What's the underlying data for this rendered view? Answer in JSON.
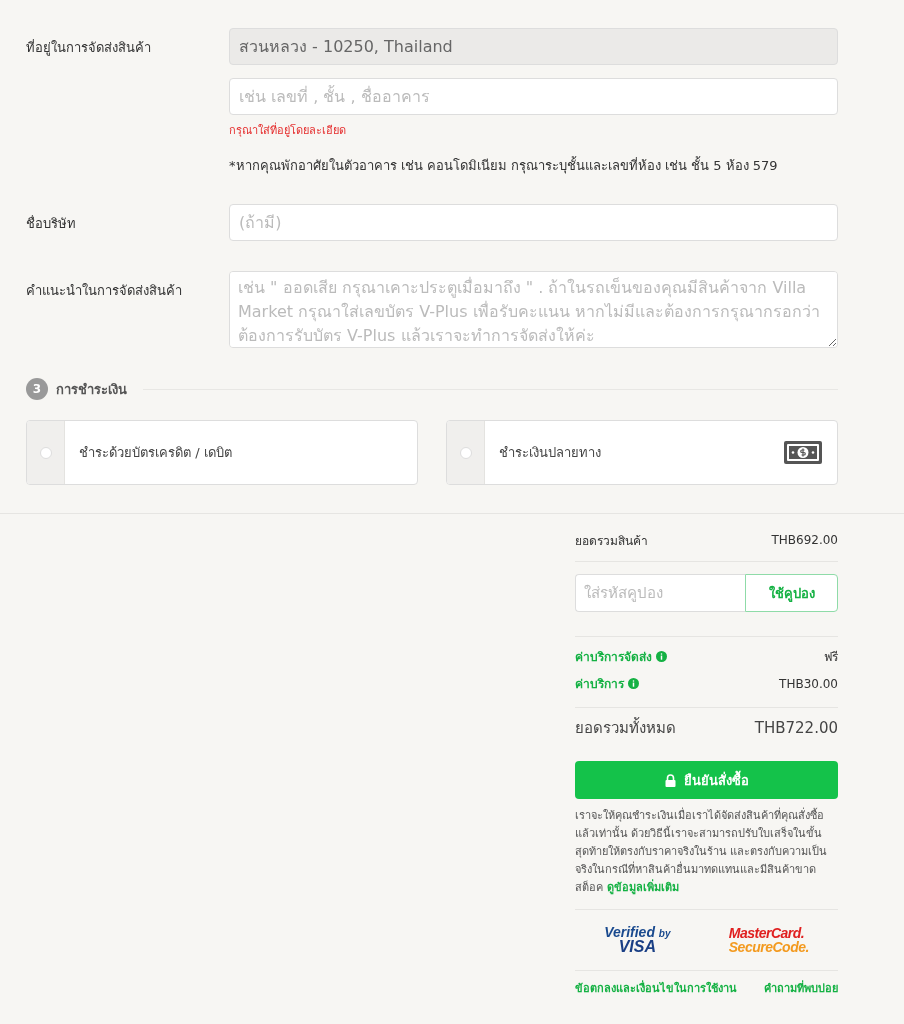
{
  "address": {
    "label": "ที่อยู่ในการจัดส่งสินค้า",
    "area_value": "สวนหลวง - 10250, Thailand",
    "detail_placeholder": "เช่น เลขที่ , ชั้น , ชื่ออาคาร",
    "error": "กรุณาใส่ที่อยู่โดยละเอียด",
    "note": "*หากคุณพักอาศัยในตัวอาคาร เช่น คอนโดมิเนียม กรุณาระบุชั้นและเลขที่ห้อง เช่น ชั้น 5 ห้อง 579"
  },
  "company": {
    "label": "ชื่อบริษัท",
    "placeholder": "(ถ้ามี)"
  },
  "instructions": {
    "label": "คำแนะนำในการจัดส่งสินค้า",
    "placeholder": "เช่น \" ออดเสีย กรุณาเคาะประตูเมื่อมาถึง \" . ถ้าในรถเข็นของคุณมีสินค้าจาก Villa Market กรุณาใส่เลขบัตร V-Plus เพื่อรับคะแนน หากไม่มีและต้องการกรุณากรอกว่าต้องการรับบัตร V-Plus แล้วเราจะทำการจัดส่งให้ค่ะ"
  },
  "payment": {
    "step": "3",
    "title": "การชำระเงิน",
    "options": [
      {
        "label": "ชำระด้วยบัตรเครดิต / เดบิต",
        "selected": false,
        "kind": "card"
      },
      {
        "label": "ชำระเงินปลายทาง",
        "selected": false,
        "kind": "cash"
      }
    ]
  },
  "summary": {
    "subtotal_label": "ยอดรวมสินค้า",
    "subtotal": "THB692.00",
    "coupon_placeholder": "ใส่รหัสคูปอง",
    "coupon_button": "ใช้คูปอง",
    "fees": [
      {
        "label": "ค่าบริการจัดส่ง",
        "value": "ฟรี"
      },
      {
        "label": "ค่าบริการ",
        "value": "THB30.00"
      }
    ],
    "total_label": "ยอดรวมทั้งหมด",
    "total": "THB722.00",
    "confirm_button": "ยืนยันสั่งซื้อ",
    "disclaimer": "เราจะให้คุณชำระเงินเมื่อเราได้จัดส่งสินค้าที่คุณสั่งซื้อแล้วเท่านั้น ด้วยวิธีนี้เราจะสามารถปรับใบเสร็จในขั้นสุดท้ายให้ตรงกับราคาจริงในร้าน และตรงกับความเป็นจริงในกรณีที่หาสินค้าอื่นมาทดแทนและมีสินค้าขาดสต็อค",
    "more_link": "ดูข้อมูลเพิ่มเติม",
    "visa": {
      "top": "Verified",
      "by": "by",
      "bottom": "VISA"
    },
    "mastercard": {
      "top": "MasterCard.",
      "bottom": "SecureCode."
    },
    "footer_links": [
      "ข้อตกลงและเงื่อนไขในการใช้งาน",
      "คำถามที่พบบ่อย"
    ]
  }
}
